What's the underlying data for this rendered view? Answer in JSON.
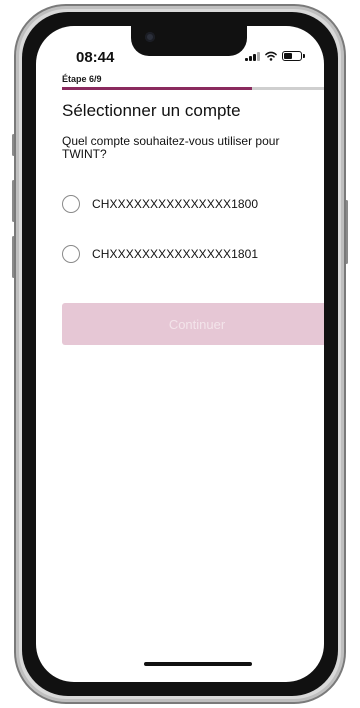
{
  "status_bar": {
    "time": "08:44",
    "icons": [
      "signal-icon",
      "wifi-icon",
      "battery-icon"
    ]
  },
  "progress": {
    "step_label": "Étape 6/9",
    "current": 6,
    "total": 9,
    "fraction": 0.667,
    "color": "#8a2a5e"
  },
  "page": {
    "title": "Sélectionner un compte",
    "question": "Quel compte souhaitez-vous utiliser pour TWINT?"
  },
  "accounts": [
    {
      "label": "CHXXXXXXXXXXXXXXX1800",
      "selected": false
    },
    {
      "label": "CHXXXXXXXXXXXXXXX1801",
      "selected": false
    }
  ],
  "actions": {
    "continue_label": "Continuer",
    "continue_enabled": false,
    "continue_color": "#e6c7d5"
  }
}
